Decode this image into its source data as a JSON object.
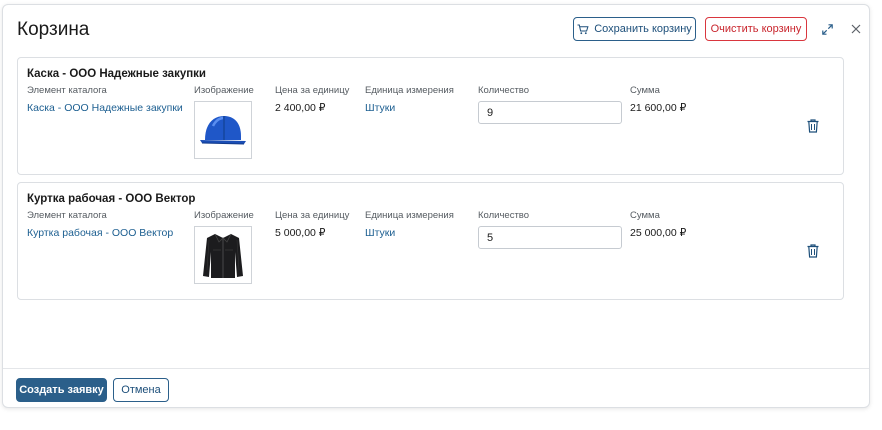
{
  "dialog": {
    "title": "Корзина",
    "save_label": "Сохранить корзину",
    "clear_label": "Очистить корзину",
    "expand_icon": "expand-icon",
    "close_icon": "close-icon"
  },
  "columns": {
    "item": "Элемент каталога",
    "image": "Изображение",
    "price": "Цена за единицу",
    "unit": "Единица измерения",
    "qty": "Количество",
    "sum": "Сумма"
  },
  "items": [
    {
      "title": "Каска - ООО Надежные закупки",
      "catalog_link": "Каска - ООО Надежные закупки",
      "image": "helmet-image",
      "price": "2 400,00 ₽",
      "unit": "Штуки",
      "qty": "9",
      "sum": "21 600,00 ₽"
    },
    {
      "title": "Куртка рабочая - ООО Вектор",
      "catalog_link": "Куртка рабочая - ООО Вектор",
      "image": "jacket-image",
      "price": "5 000,00 ₽",
      "unit": "Штуки",
      "qty": "5",
      "sum": "25 000,00 ₽"
    }
  ],
  "footer": {
    "create_label": "Создать заявку",
    "cancel_label": "Отмена"
  },
  "colors": {
    "primary": "#2b5f8a",
    "link": "#1d5f91",
    "danger": "#d9363e"
  }
}
